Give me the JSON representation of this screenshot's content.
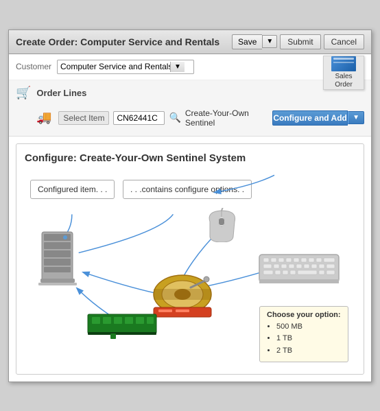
{
  "window": {
    "title": "Create Order: Computer Service and Rentals"
  },
  "header": {
    "title": "Create Order: Computer Service and Rentals",
    "save_label": "Save",
    "submit_label": "Submit",
    "cancel_label": "Cancel"
  },
  "customer": {
    "label": "Customer",
    "value": "Computer Service and Rentals",
    "placeholder": "Computer Service and Rentals"
  },
  "sales_order": {
    "label": "Sales\nOrder"
  },
  "order_lines": {
    "title": "Order Lines",
    "select_item_label": "Select Item",
    "item_code": "CN62441C",
    "item_name": "Create-Your-Own Sentinel",
    "configure_add_label": "Configure and Add"
  },
  "configure": {
    "title": "Configure: Create-Your-Own Sentinel System",
    "configured_item_label": "Configured  item. . .",
    "contains_options_label": ". . .contains configure  options. .",
    "option_box": {
      "title": "Choose your option:",
      "options": [
        "500 MB",
        "1 TB",
        "2 TB"
      ]
    }
  },
  "icons": {
    "cart": "🛒",
    "truck": "🚚",
    "search": "🔍",
    "dropdown_arrow": "▼"
  }
}
